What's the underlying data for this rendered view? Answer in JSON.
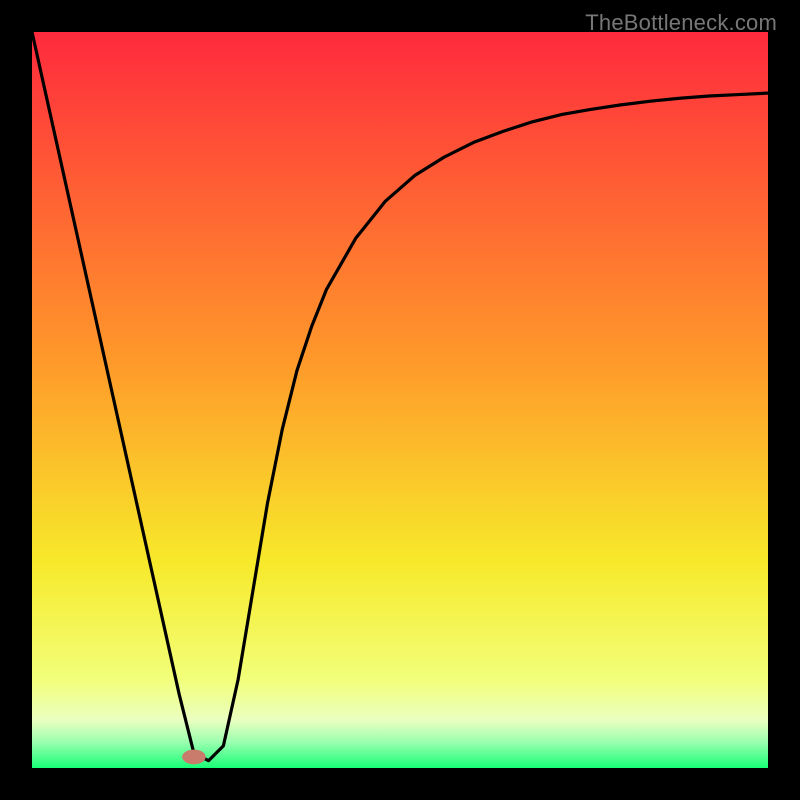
{
  "watermark": "TheBottleneck.com",
  "chart_data": {
    "type": "line",
    "title": "",
    "xlabel": "",
    "ylabel": "",
    "xlim": [
      0,
      100
    ],
    "ylim": [
      0,
      100
    ],
    "grid": false,
    "legend": false,
    "gradient_stops": [
      {
        "offset": 0.0,
        "color": "#ff2a3d"
      },
      {
        "offset": 0.45,
        "color": "#ff9a2a"
      },
      {
        "offset": 0.72,
        "color": "#f7e92a"
      },
      {
        "offset": 0.88,
        "color": "#f2ff7a"
      },
      {
        "offset": 0.935,
        "color": "#eaffc0"
      },
      {
        "offset": 0.965,
        "color": "#9affaf"
      },
      {
        "offset": 1.0,
        "color": "#18ff77"
      }
    ],
    "series": [
      {
        "name": "bottleneck-curve",
        "color": "#000000",
        "x": [
          0,
          4,
          8,
          12,
          16,
          20,
          22,
          24,
          26,
          28,
          30,
          32,
          34,
          36,
          38,
          40,
          44,
          48,
          52,
          56,
          60,
          64,
          68,
          72,
          76,
          80,
          84,
          88,
          92,
          96,
          100
        ],
        "y": [
          100,
          82,
          64,
          46,
          28,
          10,
          2,
          1,
          3,
          12,
          24,
          36,
          46,
          54,
          60,
          65,
          72,
          77,
          80.5,
          83,
          85,
          86.5,
          87.8,
          88.8,
          89.5,
          90.1,
          90.6,
          91.0,
          91.3,
          91.5,
          91.7
        ]
      }
    ],
    "marker": {
      "x": 22,
      "y": 1.5,
      "rx": 1.6,
      "ry": 1.0,
      "color": "#c97b6c"
    }
  }
}
